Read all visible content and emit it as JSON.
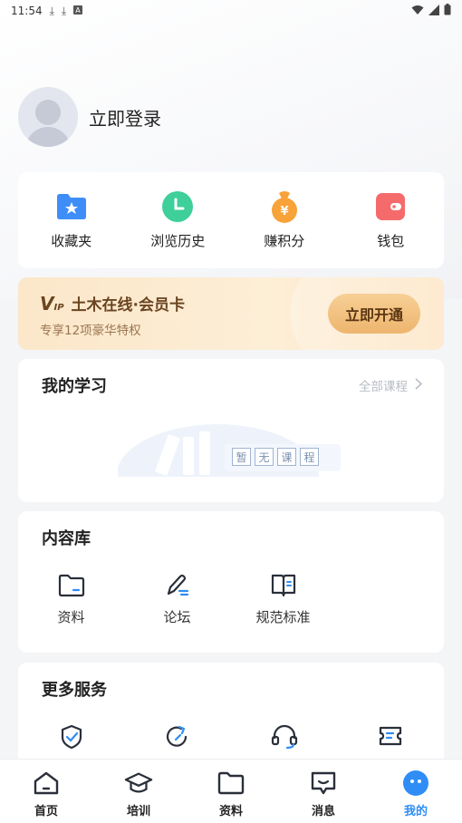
{
  "status_bar": {
    "time": "11:54"
  },
  "profile": {
    "login_label": "立即登录"
  },
  "quick_actions": [
    {
      "label": "收藏夹",
      "icon": "folder-star-icon",
      "color": "#3f8ef8"
    },
    {
      "label": "浏览历史",
      "icon": "clock-icon",
      "color": "#3ecf9b"
    },
    {
      "label": "赚积分",
      "icon": "money-bag-icon",
      "color": "#f8a23a"
    },
    {
      "label": "钱包",
      "icon": "wallet-icon",
      "color": "#f56b6b"
    }
  ],
  "vip": {
    "logo_text": "V",
    "logo_small": "IP",
    "title": "土木在线·会员卡",
    "subtitle": "专享12项豪华特权",
    "button": "立即开通"
  },
  "study": {
    "title": "我的学习",
    "all_link": "全部课程",
    "empty_chars": [
      "暂",
      "无",
      "课",
      "程"
    ]
  },
  "content_library": {
    "title": "内容库",
    "items": [
      {
        "label": "资料",
        "icon": "folder-icon"
      },
      {
        "label": "论坛",
        "icon": "pen-icon"
      },
      {
        "label": "规范标准",
        "icon": "book-icon"
      }
    ]
  },
  "more_services": {
    "title": "更多服务",
    "icons": [
      "shield-check-icon",
      "refresh-arrow-icon",
      "headset-icon",
      "ticket-icon"
    ]
  },
  "tabbar": [
    {
      "label": "首页",
      "icon": "home-icon",
      "active": false
    },
    {
      "label": "培训",
      "icon": "graduation-cap-icon",
      "active": false
    },
    {
      "label": "资料",
      "icon": "folder-icon",
      "active": false
    },
    {
      "label": "消息",
      "icon": "message-icon",
      "active": false
    },
    {
      "label": "我的",
      "icon": "smiley-icon",
      "active": true
    }
  ],
  "colors": {
    "accent": "#2f8df5",
    "vip_text": "#6b4420",
    "vip_button": "#edb56e"
  }
}
